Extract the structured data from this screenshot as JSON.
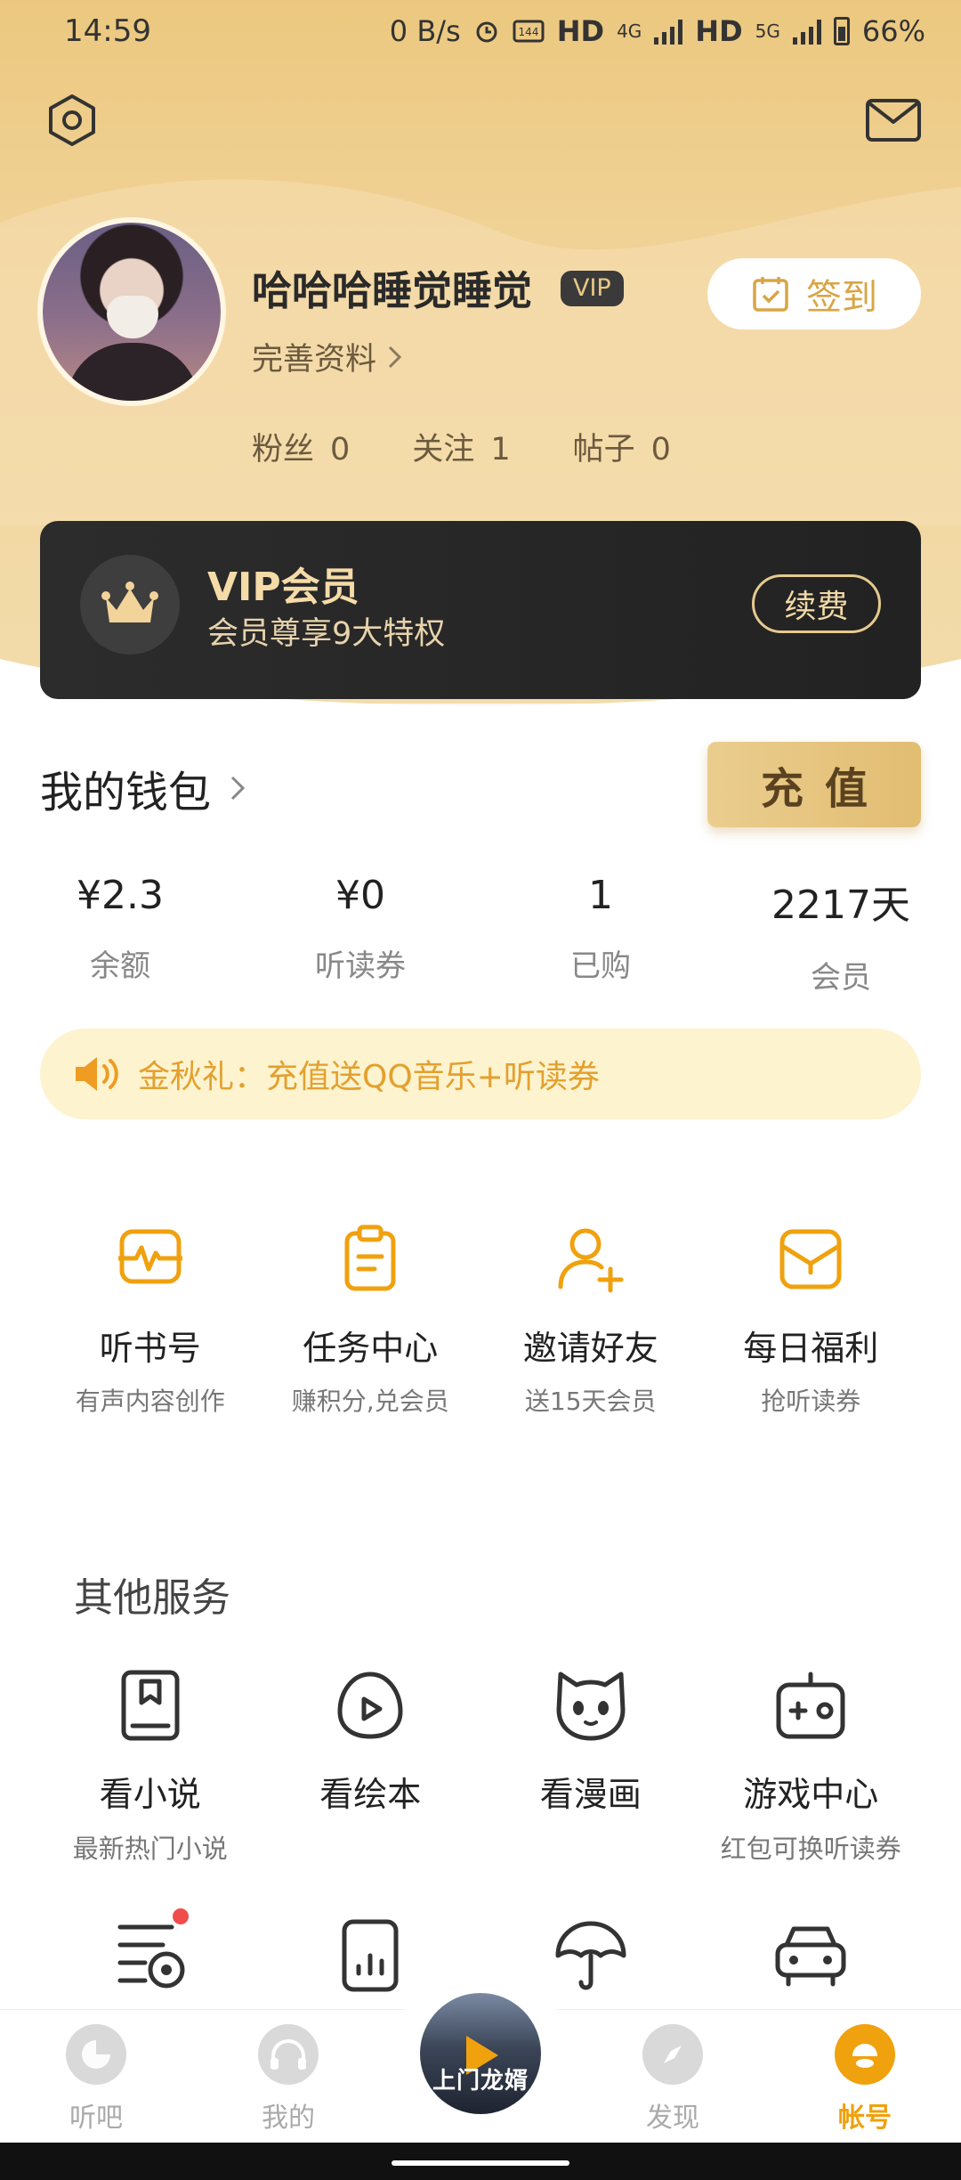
{
  "status_bar": {
    "time": "14:59",
    "network_speed": "0 B/s",
    "hd1": "HD",
    "net1": "4G",
    "hd2": "HD",
    "net2": "5G",
    "battery": "66%"
  },
  "profile": {
    "username": "哈哈哈睡觉睡觉",
    "vip_badge": "VIP",
    "complete_profile": "完善资料",
    "checkin_label": "签到",
    "stats": [
      {
        "label": "粉丝",
        "value": "0"
      },
      {
        "label": "关注",
        "value": "1"
      },
      {
        "label": "帖子",
        "value": "0"
      }
    ]
  },
  "vip_card": {
    "title": "VIP会员",
    "subtitle": "会员尊享9大特权",
    "renew_label": "续费"
  },
  "wallet": {
    "title": "我的钱包",
    "recharge_label": "充值",
    "stats": [
      {
        "value": "¥2.3",
        "label": "余额"
      },
      {
        "value": "¥0",
        "label": "听读券"
      },
      {
        "value": "1",
        "label": "已购"
      },
      {
        "value": "2217天",
        "label": "会员"
      }
    ]
  },
  "promo": {
    "text": "金秋礼：充值送QQ音乐+听读券"
  },
  "quick_actions": [
    {
      "icon": "creator-card-icon",
      "label": "听书号",
      "sub": "有声内容创作"
    },
    {
      "icon": "clipboard-task-icon",
      "label": "任务中心",
      "sub": "赚积分,兑会员"
    },
    {
      "icon": "add-friend-icon",
      "label": "邀请好友",
      "sub": "送15天会员"
    },
    {
      "icon": "gift-bag-icon",
      "label": "每日福利",
      "sub": "抢听读券"
    }
  ],
  "services": {
    "title": "其他服务",
    "items": [
      {
        "icon": "book-icon",
        "label": "看小说",
        "sub": "最新热门小说"
      },
      {
        "icon": "picture-book-icon",
        "label": "看绘本",
        "sub": ""
      },
      {
        "icon": "cat-face-icon",
        "label": "看漫画",
        "sub": ""
      },
      {
        "icon": "gamepad-icon",
        "label": "游戏中心",
        "sub": "红包可换听读券"
      }
    ],
    "row2_icons": [
      "playlist-icon",
      "phone-chart-icon",
      "umbrella-icon",
      "car-icon"
    ]
  },
  "bottom_nav": {
    "items": [
      {
        "label": "听吧"
      },
      {
        "label": "我的"
      },
      {
        "label": "发现"
      },
      {
        "label": "帐号"
      }
    ],
    "now_playing_text": "上门龙婿"
  },
  "colors": {
    "accent": "#f0a10e",
    "gold": "#e2bd72",
    "vip_dark": "#2c2c2c"
  }
}
